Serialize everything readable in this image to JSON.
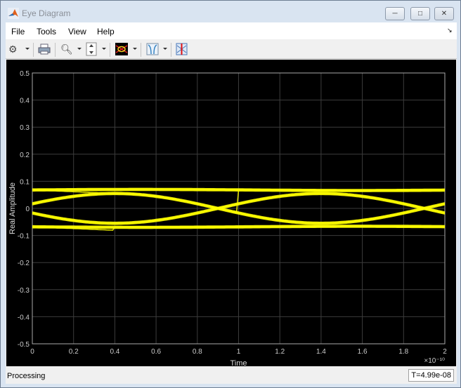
{
  "window": {
    "title": "Eye Diagram",
    "minimize_label": "─",
    "maximize_label": "□",
    "close_label": "✕"
  },
  "menu": [
    "File",
    "Tools",
    "View",
    "Help"
  ],
  "toolbar": {
    "icons": [
      "gear-icon",
      "print-icon",
      "zoom-in-icon",
      "scale-axes-icon",
      "eye-diagram-icon",
      "measurements-icon",
      "cursor-icon"
    ]
  },
  "status": {
    "text": "Processing",
    "time": "T=4.99e-08"
  },
  "chart_data": {
    "type": "line",
    "xlabel": "Time",
    "ylabel": "Real Amplitude",
    "x_exponent": "×10⁻¹⁰",
    "xlim": [
      0,
      2
    ],
    "ylim": [
      -0.5,
      0.5
    ],
    "grid": true,
    "xticks": [
      "0",
      "0.2",
      "0.4",
      "0.6",
      "0.8",
      "1",
      "1.2",
      "1.4",
      "1.6",
      "1.8",
      "2"
    ],
    "yticks": [
      "0.5",
      "0.4",
      "0.3",
      "0.2",
      "0.1",
      "0",
      "-0.1",
      "-0.2",
      "-0.3",
      "-0.4",
      "-0.5"
    ],
    "trace_color": "#ffff00",
    "levels": {
      "high": 0.068,
      "low": -0.068
    },
    "transition_amplitude": 0.055,
    "transition_peak_times": [
      0.4,
      1.4
    ]
  }
}
